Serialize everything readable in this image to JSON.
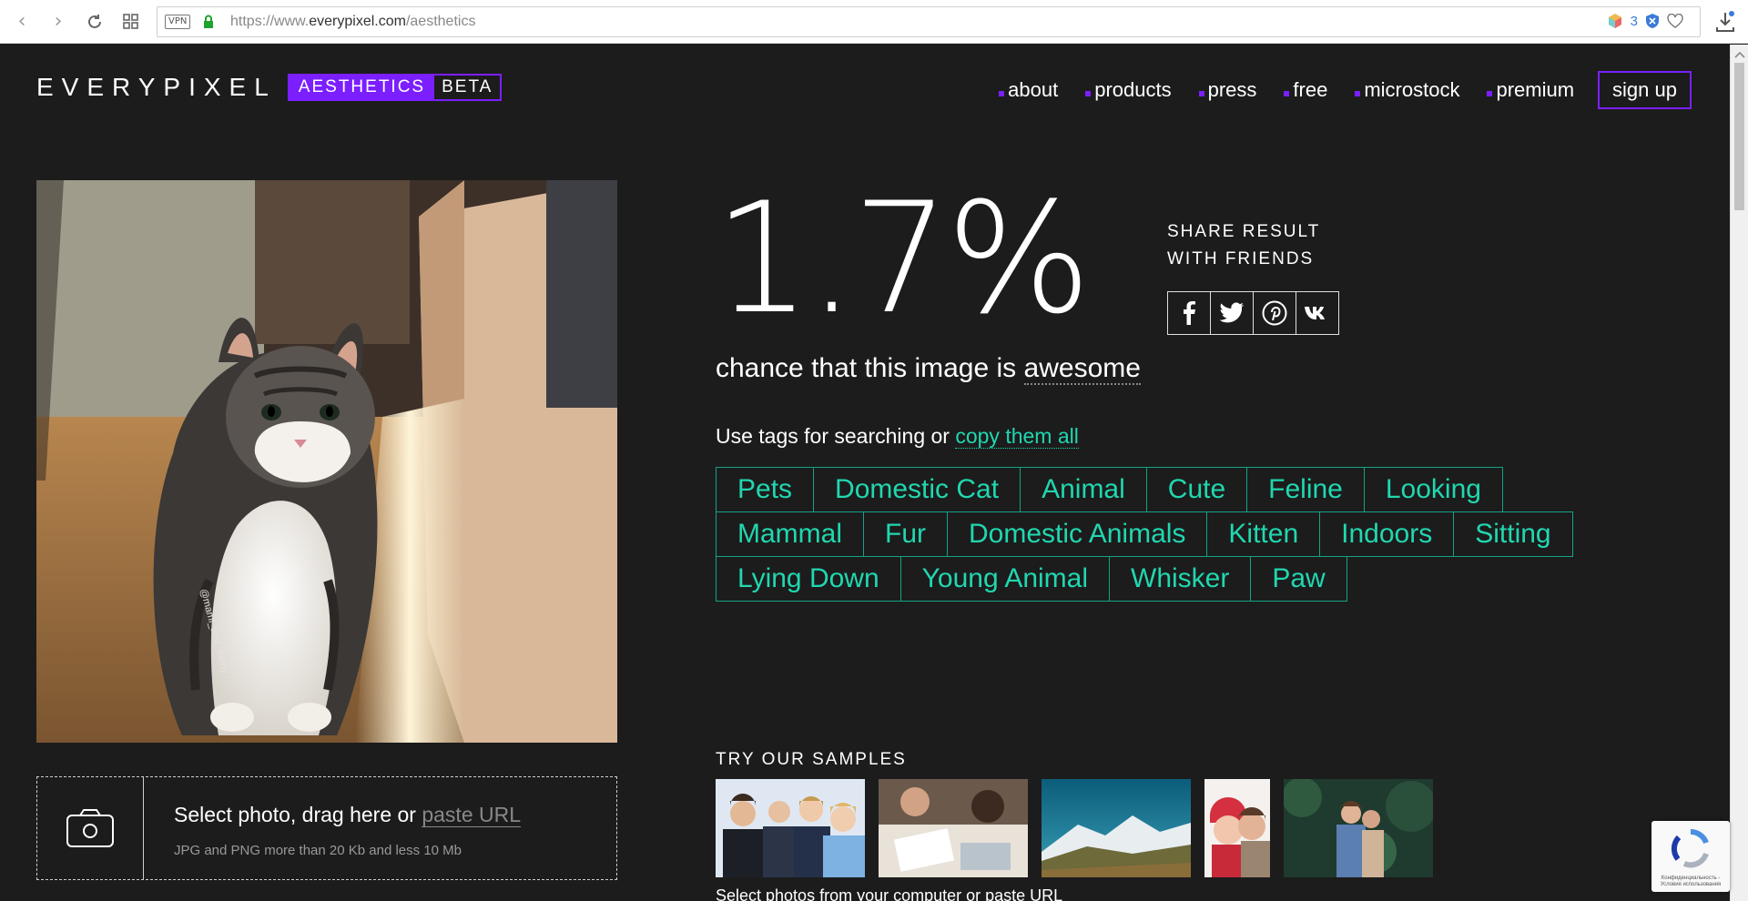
{
  "browser": {
    "vpn_label": "VPN",
    "url_prefix": "https://www.",
    "url_domain": "everypixel.com",
    "url_path": "/aesthetics",
    "extension_count": "3"
  },
  "header": {
    "logo_text": "EVERYPIXEL",
    "badge_aesthetics": "AESTHETICS",
    "badge_beta": "BETA",
    "nav": [
      "about",
      "products",
      "press",
      "free",
      "microstock",
      "premium"
    ],
    "signup_label": "sign up"
  },
  "result": {
    "score": "1.7%",
    "chance_prefix": "chance that this image is",
    "chance_word": "awesome",
    "share_line1": "SHARE RESULT",
    "share_line2": "WITH FRIENDS"
  },
  "tags": {
    "intro": "Use tags for searching or",
    "copy_link": "copy them all",
    "rows": [
      [
        "Pets",
        "Domestic Cat",
        "Animal",
        "Cute",
        "Feline",
        "Looking"
      ],
      [
        "Mammal",
        "Fur",
        "Domestic Animals",
        "Kitten",
        "Indoors",
        "Sitting"
      ],
      [
        "Lying Down",
        "Young Animal",
        "Whisker",
        "Paw"
      ]
    ]
  },
  "photo": {
    "watermark": "@mami_and_morty"
  },
  "upload": {
    "main_text": "Select photo, drag here or",
    "paste_link": "paste URL",
    "hint": "JPG and PNG more than 20 Kb and less 10 Mb"
  },
  "samples": {
    "title": "TRY OUR SAMPLES",
    "subtitle": "Select photos from your computer or paste URL"
  },
  "recaptcha": {
    "text": "Конфиденциальность - Условия использования"
  }
}
